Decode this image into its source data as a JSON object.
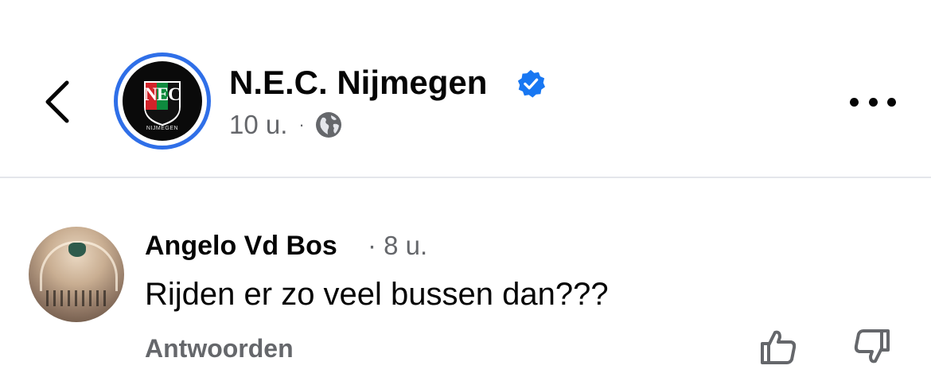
{
  "header": {
    "back_icon": "chevron-left-icon",
    "page_name": "N.E.C. Nijmegen",
    "verified_icon": "verified-badge-icon",
    "verified_color": "#1877f2",
    "avatar_ring_color": "#2f6fe8",
    "logo": {
      "letters": "NEC",
      "subtitle": "NIJMEGEN",
      "colors": [
        "#d2232a",
        "#0e8a3e",
        "#000000"
      ]
    },
    "post_time": "10 u.",
    "separator": "·",
    "audience_icon": "globe-icon",
    "more_icon": "more-horizontal-icon"
  },
  "comment": {
    "author": "Angelo Vd Bos",
    "time": "· 8 u.",
    "text": "Rijden er zo veel bussen dan???",
    "reply_label": "Antwoorden",
    "like_icon": "thumbs-up-icon",
    "dislike_icon": "thumbs-down-icon"
  }
}
